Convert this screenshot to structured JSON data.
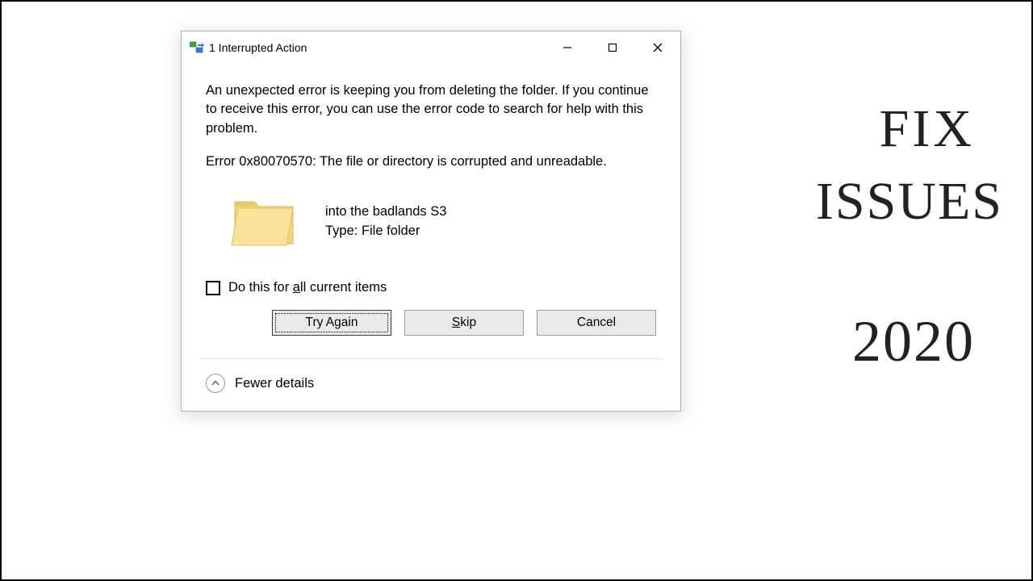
{
  "dialog": {
    "title": "1 Interrupted Action",
    "message": "An unexpected error is keeping you from deleting the folder. If you continue to receive this error, you can use the error code to search for help with this problem.",
    "error_line": "Error 0x80070570: The file or directory is corrupted and unreadable.",
    "item": {
      "name": "into the badlands S3",
      "type_label": "Type: File folder"
    },
    "checkbox_prefix": "Do this for ",
    "checkbox_underlined": "a",
    "checkbox_suffix": "ll current items",
    "buttons": {
      "try_again": "Try Again",
      "skip_prefix": "",
      "skip_underlined": "S",
      "skip_suffix": "kip",
      "cancel": "Cancel"
    },
    "footer_label": "Fewer details"
  },
  "annotation": {
    "line1": "FIX",
    "line2": "ISSUES",
    "line3": "2020"
  }
}
